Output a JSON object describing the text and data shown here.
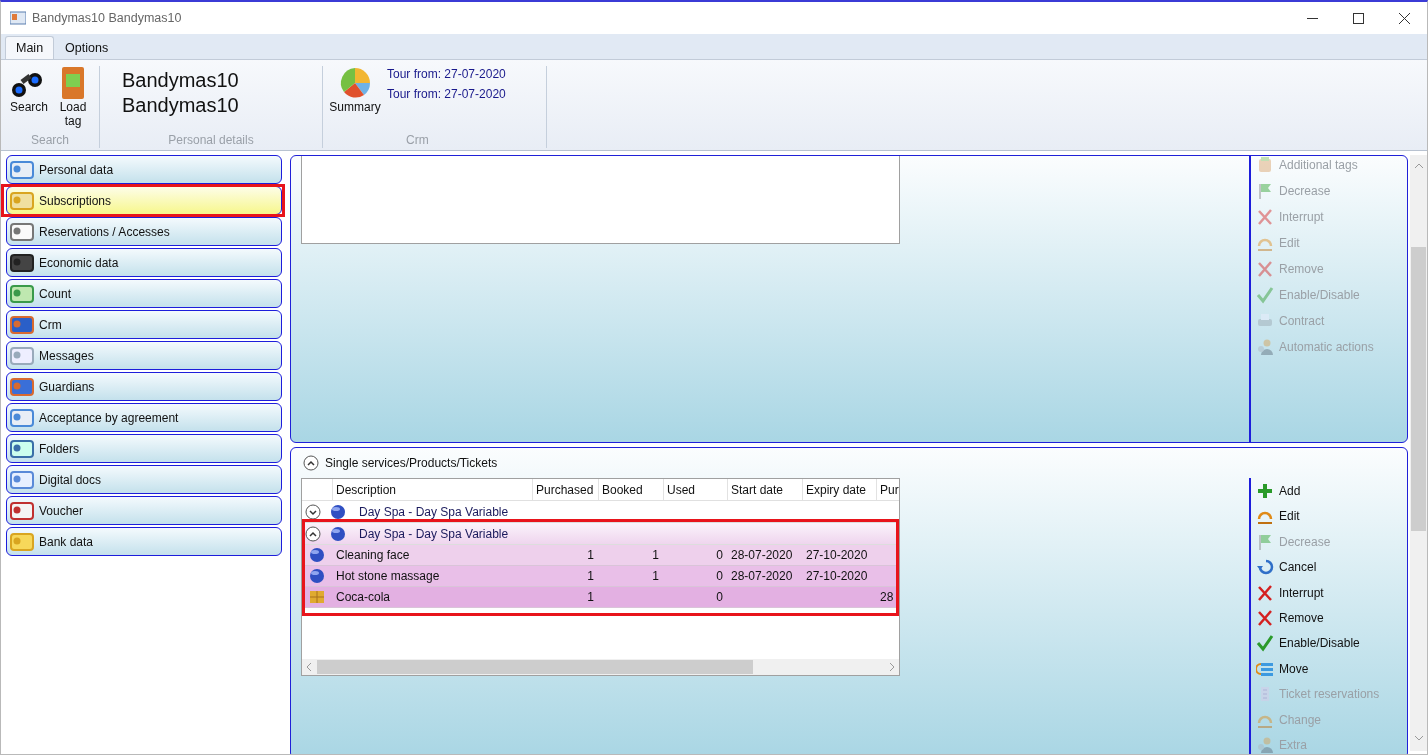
{
  "window": {
    "title": "Bandymas10 Bandymas10"
  },
  "ribbon": {
    "tabs": [
      {
        "label": "Main",
        "selected": true
      },
      {
        "label": "Options",
        "selected": false
      }
    ],
    "groups": [
      {
        "kind": "buttons",
        "caption": "Search",
        "buttons": [
          "Search",
          "Load tag"
        ]
      },
      {
        "kind": "names",
        "caption": "Personal details",
        "lines": [
          "Bandymas10",
          "Bandymas10"
        ]
      },
      {
        "kind": "notes",
        "caption": "Crm",
        "buttons": [
          "Summary"
        ],
        "lines": [
          "Tour from: 27-07-2020",
          "Tour from: 27-07-2020"
        ]
      }
    ]
  },
  "sidebar": {
    "items": [
      {
        "label": "Personal data",
        "selected": false,
        "highlighted": false
      },
      {
        "label": "Subscriptions",
        "selected": true,
        "highlighted": true
      },
      {
        "label": "Reservations / Accesses",
        "selected": false,
        "highlighted": false
      },
      {
        "label": "Economic data",
        "selected": false,
        "highlighted": false
      },
      {
        "label": "Count",
        "selected": false,
        "highlighted": false
      },
      {
        "label": "Crm",
        "selected": false,
        "highlighted": false
      },
      {
        "label": "Messages",
        "selected": false,
        "highlighted": false
      },
      {
        "label": "Guardians",
        "selected": false,
        "highlighted": false
      },
      {
        "label": "Acceptance by agreement",
        "selected": false,
        "highlighted": false
      },
      {
        "label": "Folders",
        "selected": false,
        "highlighted": false
      },
      {
        "label": "Digital docs",
        "selected": false,
        "highlighted": false
      },
      {
        "label": "Voucher",
        "selected": false,
        "highlighted": false
      },
      {
        "label": "Bank data",
        "selected": false,
        "highlighted": false
      }
    ]
  },
  "upper_panel": {
    "actions": [
      {
        "label": "Additional tags",
        "disabled": true
      },
      {
        "label": "Decrease",
        "disabled": true
      },
      {
        "label": "Interrupt",
        "disabled": true
      },
      {
        "label": "Edit",
        "disabled": true
      },
      {
        "label": "Remove",
        "disabled": true
      },
      {
        "label": "Enable/Disable",
        "disabled": true
      },
      {
        "label": "Contract",
        "disabled": true
      },
      {
        "label": "Automatic actions",
        "disabled": true
      }
    ]
  },
  "lower_panel": {
    "title": "Single services/Products/Tickets",
    "expanded": true,
    "table": {
      "columns": [
        "Description",
        "Purchased",
        "Booked",
        "Used",
        "Start date",
        "Expiry date",
        "Pur"
      ],
      "rows": [
        {
          "kind": "group",
          "label": "Day Spa - Day Spa Variable",
          "expanded": false,
          "highlighted": false
        },
        {
          "kind": "group",
          "label": "Day Spa - Day Spa Variable",
          "expanded": true,
          "highlighted": true,
          "children": [
            {
              "kind": "service",
              "cells": [
                "Cleaning face",
                "1",
                "1",
                "0",
                "28-07-2020",
                "27-10-2020",
                null
              ]
            },
            {
              "kind": "service",
              "cells": [
                "Hot stone massage",
                "1",
                "1",
                "0",
                "28-07-2020",
                "27-10-2020",
                null
              ]
            },
            {
              "kind": "product",
              "cells": [
                "Coca-cola",
                "1",
                null,
                "0",
                null,
                null,
                "28"
              ]
            }
          ]
        }
      ]
    },
    "actions": [
      {
        "label": "Add",
        "disabled": false
      },
      {
        "label": "Edit",
        "disabled": false
      },
      {
        "label": "Decrease",
        "disabled": true
      },
      {
        "label": "Cancel",
        "disabled": false
      },
      {
        "label": "Interrupt",
        "disabled": false
      },
      {
        "label": "Remove",
        "disabled": false
      },
      {
        "label": "Enable/Disable",
        "disabled": false
      },
      {
        "label": "Move",
        "disabled": false
      },
      {
        "label": "Ticket reservations",
        "disabled": true
      },
      {
        "label": "Change",
        "disabled": true
      },
      {
        "label": "Extra",
        "disabled": true
      }
    ]
  }
}
